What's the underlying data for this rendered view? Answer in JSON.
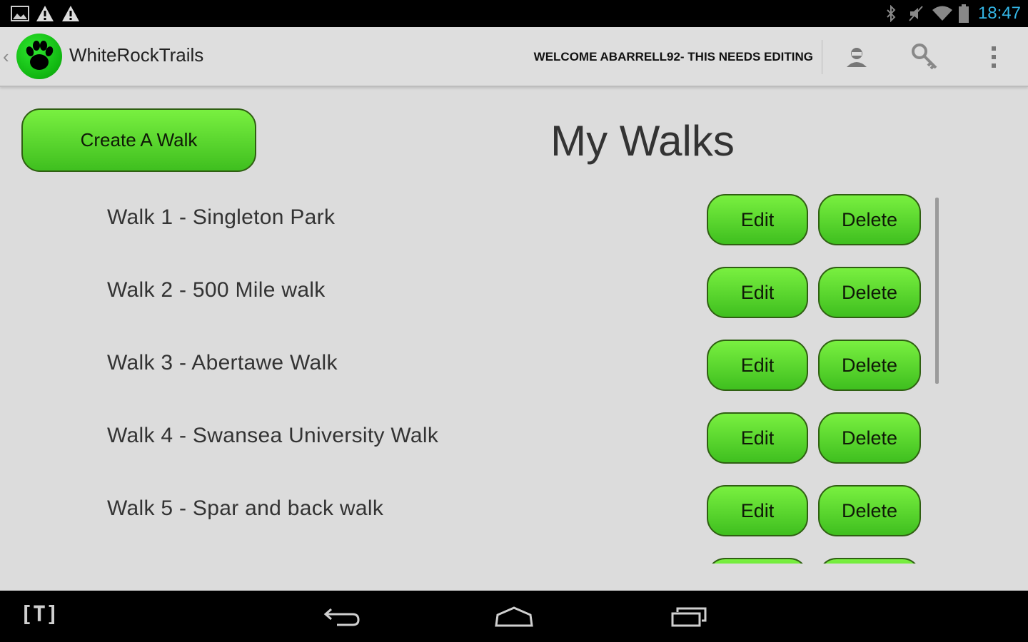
{
  "status_bar": {
    "time": "18:47",
    "icons": [
      "image-notification-icon",
      "warning-icon",
      "warning-icon",
      "bluetooth-icon",
      "muted-icon",
      "wifi-icon",
      "battery-icon"
    ]
  },
  "action_bar": {
    "title": "WhiteRockTrails",
    "welcome": "WELCOME ABARRELL92- THIS NEEDS EDITING",
    "icons": [
      "back-chevron-icon",
      "paw-logo-icon",
      "profile-icon",
      "key-icon",
      "overflow-menu-icon"
    ]
  },
  "content": {
    "create_button": "Create A Walk",
    "page_title": "My Walks",
    "walks": [
      {
        "label": "Walk 1 - Singleton Park",
        "edit": "Edit",
        "delete": "Delete"
      },
      {
        "label": "Walk 2 - 500 Mile walk",
        "edit": "Edit",
        "delete": "Delete"
      },
      {
        "label": "Walk 3 - Abertawe Walk",
        "edit": "Edit",
        "delete": "Delete"
      },
      {
        "label": "Walk 4 - Swansea University Walk",
        "edit": "Edit",
        "delete": "Delete"
      },
      {
        "label": "Walk 5 - Spar and back walk",
        "edit": "Edit",
        "delete": "Delete"
      },
      {
        "label": "",
        "edit": "",
        "delete": ""
      }
    ]
  },
  "nav_bar": {
    "left_label": "[T]",
    "icons": [
      "back-icon",
      "home-icon",
      "recent-apps-icon"
    ]
  },
  "colors": {
    "accent_green": "#4fd12a",
    "status_time": "#33b5e5",
    "background": "#dcdcdc"
  }
}
